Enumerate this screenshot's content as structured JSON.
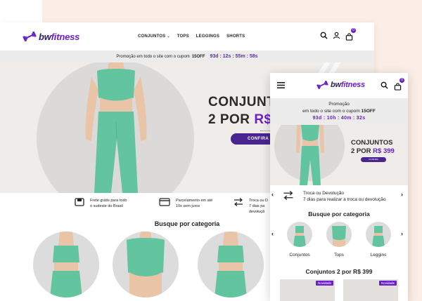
{
  "brand": {
    "name_prefix": "bw",
    "name_suffix": "fitness",
    "accent": "#6a1fc8",
    "dark_accent": "#4a248f"
  },
  "desktop": {
    "menu": [
      "CONJUNTOS",
      "TOPS",
      "LEGGINGS",
      "SHORTS"
    ],
    "cart_count": "0",
    "promo": {
      "text": "Promoção em todo o site com o cupom",
      "code": "15OFF",
      "timer": "93d : 12s : 55m : 58s"
    },
    "hero": {
      "line1": "CONJUNTOS",
      "line2_a": "2 POR ",
      "line2_b": "R$",
      "button": "CONFIRA"
    },
    "benefits": [
      {
        "icon": "truck-icon",
        "line1": "Frete grátis para todo",
        "line2": "o sudeste do Brasil"
      },
      {
        "icon": "credit-card-icon",
        "line1": "Parcelamento em até",
        "line2": "10x sem juros"
      },
      {
        "icon": "exchange-icon",
        "line1": "Troca ou D",
        "line2": "7 dias pa",
        "line3": "devoluçã"
      }
    ],
    "category_title": "Busque por categoria"
  },
  "mobile": {
    "cart_count": "0",
    "promo": {
      "line1": "Promoção",
      "line2": "em todo o site com o cupom",
      "code": "15OFF",
      "timer": "93d : 10h : 40m : 32s"
    },
    "hero": {
      "line1": "CONJUNTOS",
      "line2_a": "2 POR ",
      "line2_b": "R$ 399",
      "button": "CONFIRA"
    },
    "benefit": {
      "title": "Troca ou Devolução",
      "text": "7 dias para realizar a troca ou devolução"
    },
    "category_title": "Busque por categoria",
    "categories": [
      "Conjuntos",
      "Tops",
      "Leggins"
    ],
    "section_title": "Conjuntos 2 por R$ 399",
    "badge": "Novidade"
  },
  "colors": {
    "mint": "#63c4a0",
    "skin": "#e9c4a6",
    "bg_peach": "#fbeee6"
  }
}
